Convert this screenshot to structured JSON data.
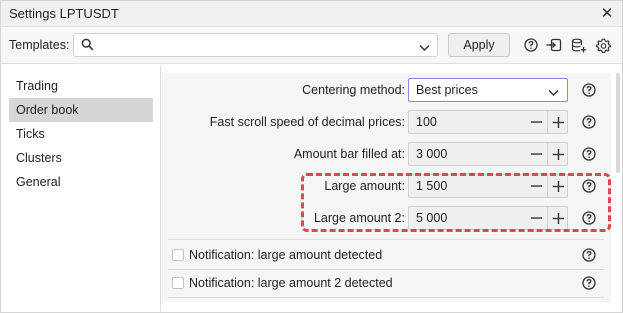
{
  "window": {
    "title": "Settings LPTUSDT"
  },
  "templates": {
    "label": "Templates:",
    "value": "",
    "apply_label": "Apply"
  },
  "sidebar": {
    "items": [
      {
        "label": "Trading",
        "active": false
      },
      {
        "label": "Order book",
        "active": true
      },
      {
        "label": "Ticks",
        "active": false
      },
      {
        "label": "Clusters",
        "active": false
      },
      {
        "label": "General",
        "active": false
      }
    ]
  },
  "settings": {
    "centering": {
      "label": "Centering method:",
      "value": "Best prices"
    },
    "fast_scroll": {
      "label": "Fast scroll speed of decimal prices:",
      "value": "100"
    },
    "amount_bar": {
      "label": "Amount bar filled at:",
      "value": "3 000"
    },
    "large_amount": {
      "label": "Large amount:",
      "value": "1 500"
    },
    "large_amount_2": {
      "label": "Large amount 2:",
      "value": "5 000"
    },
    "notify_large": {
      "label": "Notification: large amount detected",
      "checked": false
    },
    "notify_large_2": {
      "label": "Notification: large amount 2 detected",
      "checked": false
    }
  },
  "icons": {
    "close": "close-icon",
    "search": "search-icon",
    "help": "help-icon",
    "import": "import-icon",
    "export": "export-icon",
    "settings": "gear-icon",
    "minus": "minus-icon",
    "plus": "plus-icon",
    "chevron": "chevron-down-icon"
  },
  "colors": {
    "highlight": "#e0474c",
    "select_focus_border": "#9a7fe0",
    "sidebar_active": "#d6d6d6",
    "content_bg": "#f5f5f5"
  }
}
